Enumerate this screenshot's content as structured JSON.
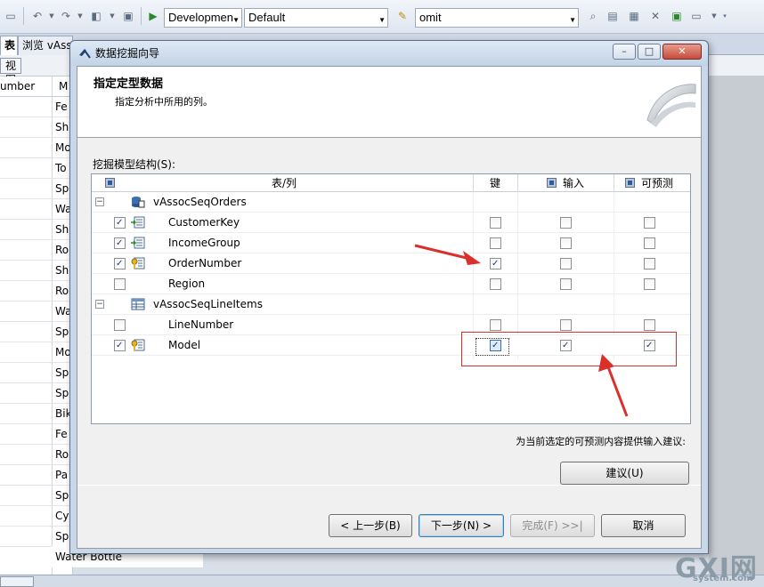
{
  "toolbar": {
    "config_value": "Developmen",
    "platform_value": "Default",
    "filter_value": "omit"
  },
  "tabs": [
    {
      "label": "表"
    },
    {
      "label": "浏览 vAsso"
    }
  ],
  "view_button": "视图",
  "background_grid": {
    "col_header": "umber",
    "col_header2": "M",
    "rows": [
      "Fe",
      "Sh",
      "Mo",
      "To",
      "Sp",
      "Wa",
      "Sh",
      "Ro",
      "Sh",
      "Ro",
      "Wa",
      "Sp",
      "Mo",
      "Sp",
      "Sp",
      "Bik",
      "Fe",
      "Ro",
      "Pa",
      "Sp",
      "Cy",
      "Sp"
    ],
    "bottom_text": "Water Bottle"
  },
  "dialog": {
    "title": "数据挖掘向导",
    "header_title": "指定定型数据",
    "header_subtitle": "指定分析中所用的列。",
    "structure_label": "挖掘模型结构(S):",
    "columns": {
      "table_col": "表/列",
      "key": "键",
      "input": "输入",
      "predict": "可预测"
    },
    "rows": [
      {
        "label": "vAssocSeqOrders",
        "type": "table",
        "expander": "−",
        "include": null,
        "key": null,
        "input": null,
        "predict": null
      },
      {
        "label": "CustomerKey",
        "type": "column",
        "include": true,
        "key": false,
        "input": false,
        "predict": false
      },
      {
        "label": "IncomeGroup",
        "type": "column",
        "include": true,
        "key": false,
        "input": false,
        "predict": false
      },
      {
        "label": "OrderNumber",
        "type": "key-column",
        "include": true,
        "key": true,
        "input": false,
        "predict": false
      },
      {
        "label": "Region",
        "type": "column",
        "include": false,
        "key": false,
        "input": false,
        "predict": false
      },
      {
        "label": "vAssocSeqLineItems",
        "type": "table",
        "expander": "−",
        "include": null,
        "key": null,
        "input": null,
        "predict": null
      },
      {
        "label": "LineNumber",
        "type": "column",
        "include": false,
        "key": false,
        "input": false,
        "predict": false
      },
      {
        "label": "Model",
        "type": "key-column",
        "include": true,
        "key": true,
        "input": true,
        "predict": true
      }
    ],
    "hint": "为当前选定的可预测内容提供输入建议:",
    "suggest_button": "建议(U)",
    "back_button": "< 上一步(B)",
    "next_button": "下一步(N) >",
    "finish_button": "完成(F) >>|",
    "cancel_button": "取消"
  },
  "watermark": {
    "big": "GXI网",
    "small": "system.com"
  },
  "colors": {
    "annotation_red": "#d9302a"
  }
}
